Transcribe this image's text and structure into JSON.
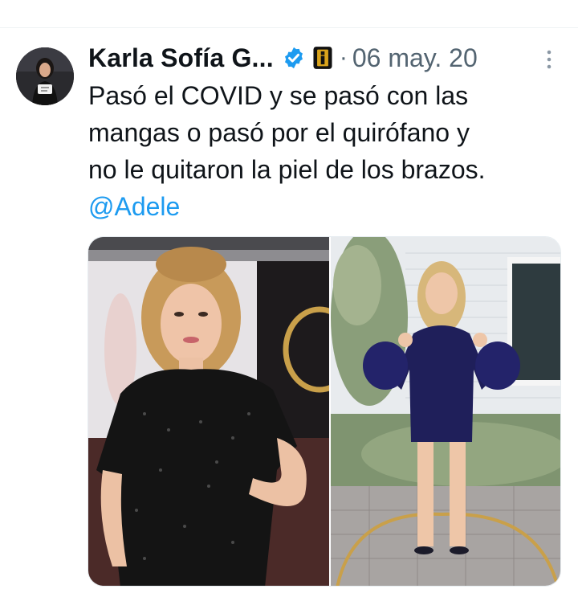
{
  "tweet": {
    "author": {
      "display_name": "Karla Sofía G...",
      "verified_icon": "verified-badge-icon",
      "affiliate_badge_icon": "affiliate-badge-icon"
    },
    "separator": "·",
    "timestamp": "06 may. 20",
    "text_lines": [
      "Pasó el COVID y se pasó con las",
      "mangas o pasó por el quirófano y",
      "no le quitaron la piel de los brazos."
    ],
    "mention": "@Adele",
    "media": {
      "left_image": "woman-black-dress-photo",
      "right_image": "woman-blue-dress-photo"
    },
    "more_icon": "more-options-icon"
  },
  "colors": {
    "text": "#0f1419",
    "secondary": "#536471",
    "accent": "#1d9bf0"
  }
}
